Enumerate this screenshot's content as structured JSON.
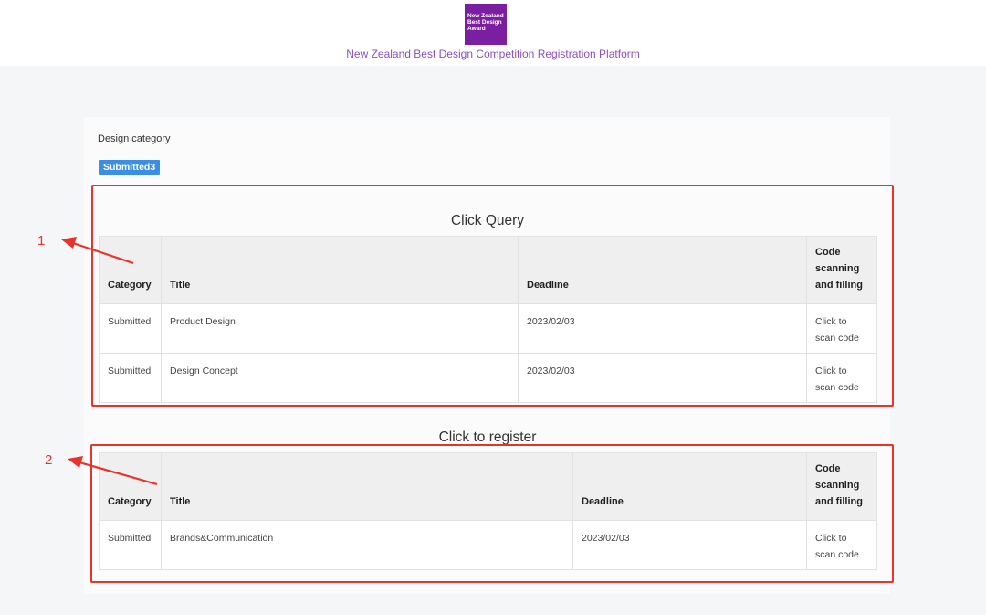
{
  "header": {
    "logo_lines": [
      "New Zealand",
      "Best Design",
      "Award"
    ],
    "platform_title": "New Zealand Best Design Competition Registration Platform"
  },
  "card": {
    "category_label": "Design category",
    "badge": "Submitted3"
  },
  "query_section": {
    "title": "Click Query",
    "columns": [
      "Category",
      "Title",
      "Deadline",
      "Code scanning and filling"
    ],
    "rows": [
      {
        "category": "Submitted",
        "title": "Product Design",
        "deadline": "2023/02/03",
        "scan": "Click to scan code"
      },
      {
        "category": "Submitted",
        "title": "Design Concept",
        "deadline": "2023/02/03",
        "scan": "Click to scan code"
      }
    ]
  },
  "register_section": {
    "title": "Click to register",
    "columns": [
      "Category",
      "Title",
      "Deadline",
      "Code scanning and filling"
    ],
    "rows": [
      {
        "category": "Submitted",
        "title": "Brands&Communication",
        "deadline": "2023/02/03",
        "scan": "Click to scan code"
      }
    ]
  },
  "annotations": [
    "1",
    "2"
  ],
  "colors": {
    "brand_purple": "#7b1fa2",
    "badge_blue": "#3a8ee6",
    "status_red": "#d9302a",
    "link_blue": "#4a8fd8",
    "annotation_red": "#e8332a"
  }
}
